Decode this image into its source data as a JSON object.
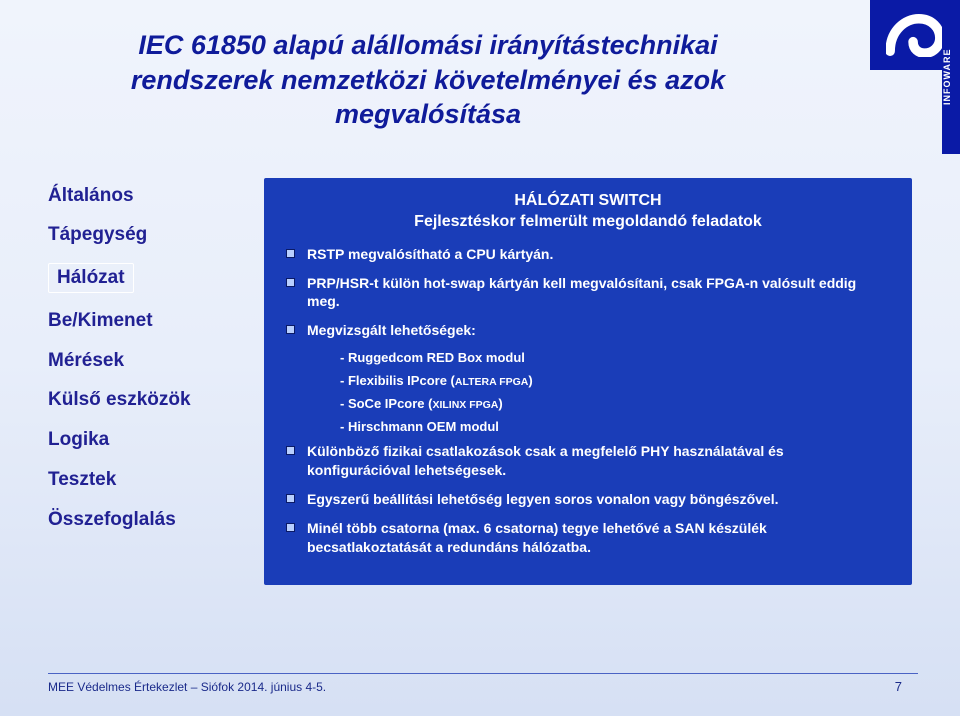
{
  "logo_side_label": "INFOWARE",
  "title_line1": "IEC 61850 alapú alállomási irányítástechnikai",
  "title_line2": "rendszerek nemzetközi követelményei és azok",
  "title_line3": "megvalósítása",
  "sidebar": {
    "items": [
      "Általános",
      "Tápegység",
      "Hálózat",
      "Be/Kimenet",
      "Mérések",
      "Külső eszközök",
      "Logika",
      "Tesztek",
      "Összefoglalás"
    ],
    "active_index": 2
  },
  "content": {
    "heading": "HÁLÓZATI SWITCH",
    "subheading": "Fejlesztéskor felmerült megoldandó feladatok",
    "bullets": [
      "RSTP megvalósítható a CPU kártyán.",
      "PRP/HSR-t külön hot-swap kártyán kell megvalósítani, csak FPGA-n valósult eddig meg.",
      "Megvizsgált lehetőségek:"
    ],
    "subitems": [
      {
        "pre": "- Ruggedcom RED Box modul",
        "small": ""
      },
      {
        "pre": "- Flexibilis IPcore (",
        "small": "ALTERA FPGA",
        "post": ")"
      },
      {
        "pre": "- SoCe IPcore (",
        "small": "XILINX FPGA",
        "post": ")"
      },
      {
        "pre": "- Hirschmann OEM modul",
        "small": ""
      }
    ],
    "bullets_after": [
      "Különböző fizikai csatlakozások csak a megfelelő PHY használatával és konfigurációval lehetségesek.",
      "Egyszerű beállítási lehetőség legyen soros vonalon vagy böngészővel.",
      "Minél több csatorna (max. 6 csatorna) tegye lehetővé  a  SAN készülék becsatlakoztatását a redundáns hálózatba."
    ]
  },
  "footer_text": "MEE Védelmes Értekezlet – Siófok 2014. június 4-5.",
  "page_number": "7"
}
